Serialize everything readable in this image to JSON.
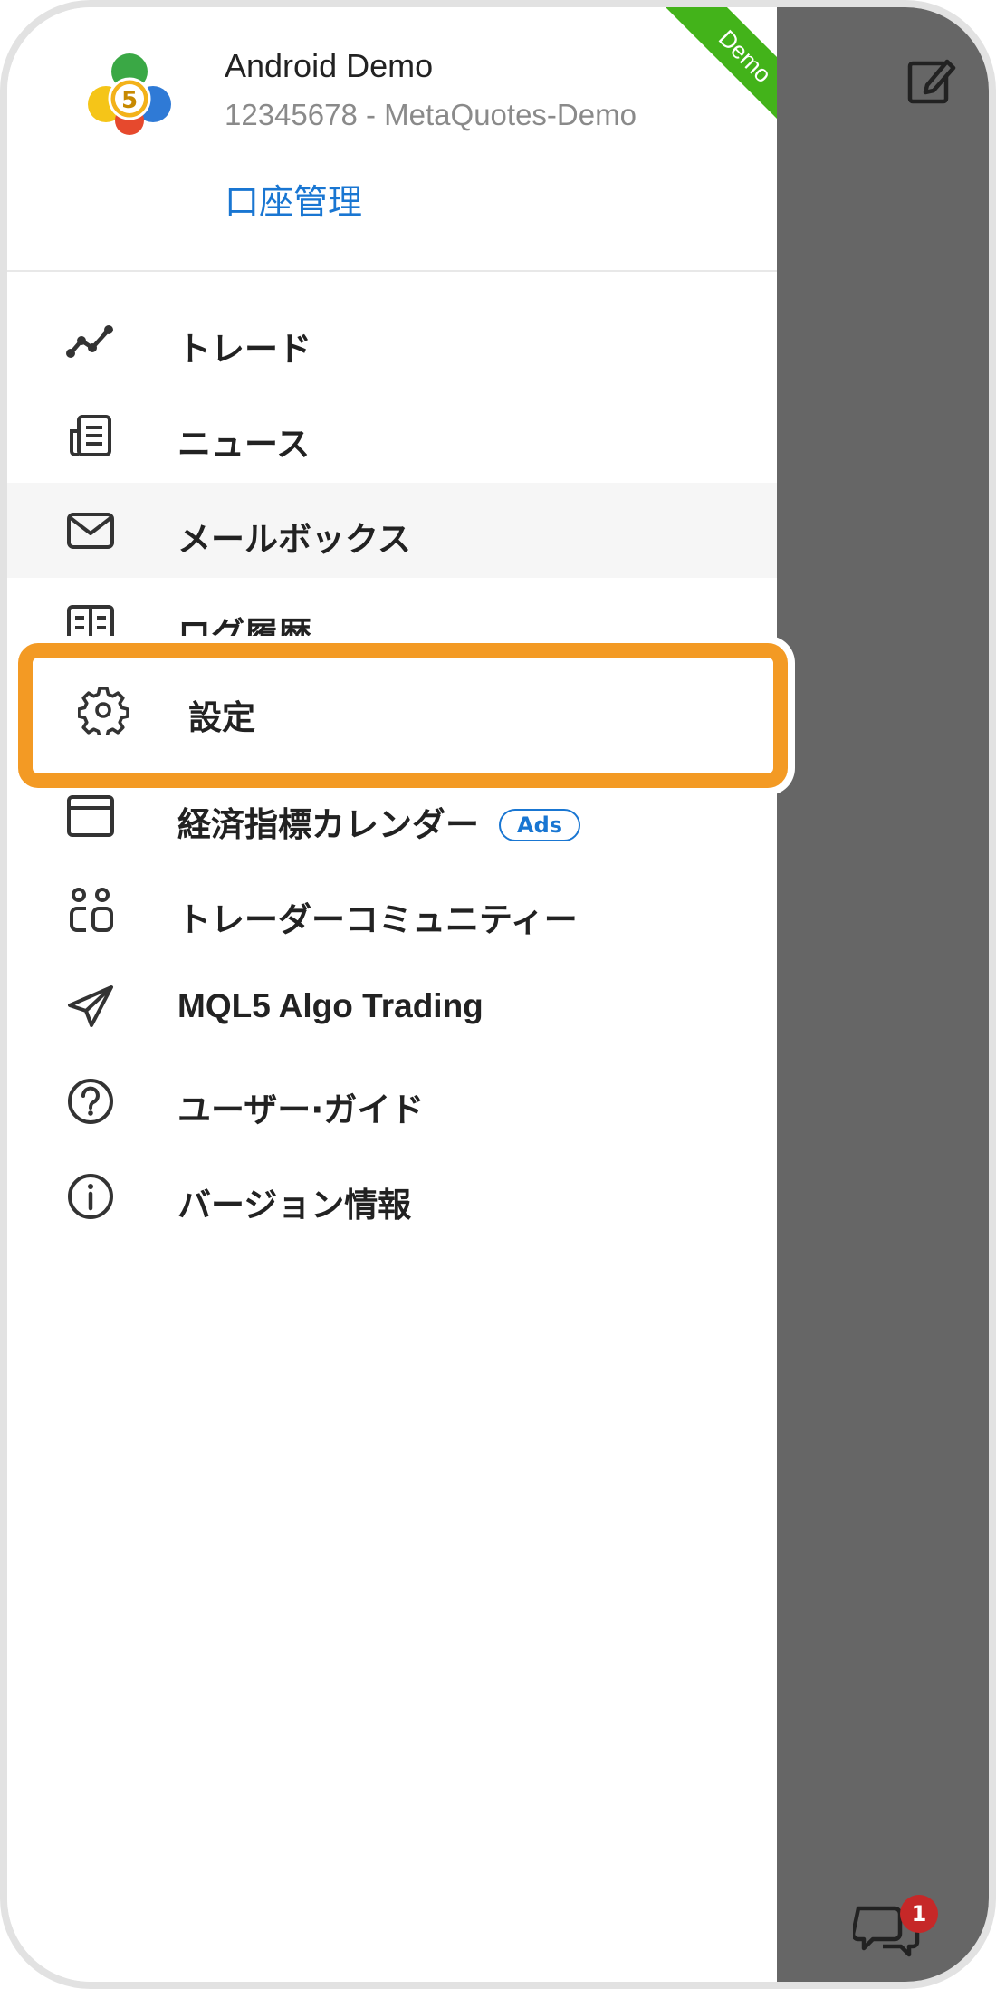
{
  "account": {
    "name": "Android Demo",
    "number": "12345678",
    "server": "- MetaQuotes-Demo",
    "manage_label": "口座管理",
    "badge": "Demo"
  },
  "menu": {
    "items": [
      {
        "label": "トレード",
        "icon": "trade-chart-icon"
      },
      {
        "label": "ニュース",
        "icon": "news-icon"
      },
      {
        "label": "メールボックス",
        "icon": "mail-icon"
      },
      {
        "label": "ログ履歴",
        "icon": "journal-icon"
      },
      {
        "label": "設定",
        "icon": "gear-icon"
      },
      {
        "label": "経済指標カレンダー",
        "icon": "calendar-icon",
        "badge": "Ads"
      },
      {
        "label": "トレーダーコミュニティー",
        "icon": "community-icon"
      },
      {
        "label": "MQL5 Algo Trading",
        "icon": "send-icon"
      },
      {
        "label": "ユーザー·ガイド",
        "icon": "help-icon"
      },
      {
        "label": "バージョン情報",
        "icon": "info-icon"
      }
    ]
  },
  "chat": {
    "badge_count": "1"
  },
  "colors": {
    "accent": "#1976d2",
    "highlight": "#f39a24",
    "demo_ribbon": "#43b31a",
    "overlay": "#666666"
  }
}
